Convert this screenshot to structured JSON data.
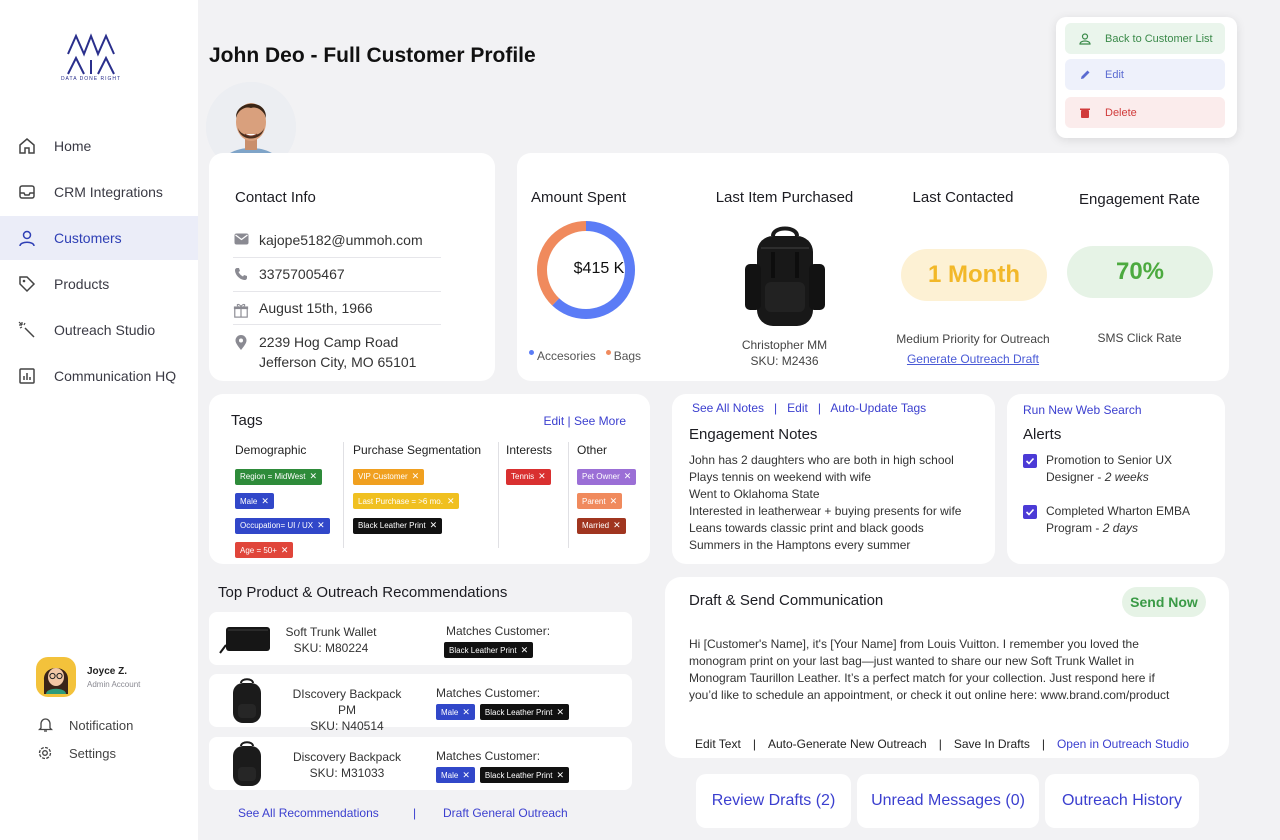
{
  "brand": {
    "name": "MINEME",
    "tagline": "DATA DONE RIGHT"
  },
  "sidebar": {
    "items": [
      {
        "label": "Home",
        "icon": "home-icon"
      },
      {
        "label": "CRM Integrations",
        "icon": "inbox-icon"
      },
      {
        "label": "Customers",
        "icon": "person-icon",
        "active": true
      },
      {
        "label": "Products",
        "icon": "tag-icon"
      },
      {
        "label": "Outreach Studio",
        "icon": "magic-wand-icon"
      },
      {
        "label": "Communication HQ",
        "icon": "bar-chart-icon"
      }
    ],
    "user": {
      "name": "Joyce Z.",
      "role": "Admin Account"
    },
    "notification_label": "Notification",
    "settings_label": "Settings"
  },
  "page": {
    "title": "John Deo - Full Customer Profile"
  },
  "actions": {
    "back_label": "Back to Customer List",
    "edit_label": "Edit",
    "delete_label": "Delete"
  },
  "contact": {
    "title": "Contact Info",
    "email": "kajope5182@ummoh.com",
    "phone": "33757005467",
    "birthday": "August 15th, 1966",
    "address_line1": "2239  Hog Camp Road",
    "address_line2": "Jefferson City, MO 65101"
  },
  "stats": {
    "amount_title": "Amount Spent",
    "amount_value": "$415 K",
    "legend": [
      "Accesories",
      "Bags"
    ],
    "donut": {
      "accessories_fraction": 0.62,
      "bags_fraction": 0.38,
      "colors": [
        "#5b7cf6",
        "#f08a5d"
      ]
    },
    "last_item_title": "Last Item Purchased",
    "last_item_name": "Christopher MM",
    "last_item_sku": "SKU: M2436",
    "last_contacted_title": "Last Contacted",
    "last_contacted_value": "1 Month",
    "priority_text": "Medium Priority for Outreach",
    "generate_link": "Generate Outreach Draft",
    "engagement_title": "Engagement Rate",
    "engagement_value": "70%",
    "engagement_sub": "SMS Click Rate"
  },
  "tags": {
    "title": "Tags",
    "edit_link": "Edit | See More",
    "columns": [
      {
        "title": "Demographic",
        "tags": [
          {
            "label": "Region = MidWest",
            "color": "#2e8b3a"
          },
          {
            "label": "Male",
            "color": "#3147c9"
          },
          {
            "label": "Occupation= UI / UX",
            "color": "#3147c9"
          },
          {
            "label": "Age = 50+",
            "color": "#e0453a"
          }
        ]
      },
      {
        "title": "Purchase Segmentation",
        "tags": [
          {
            "label": "VIP Customer",
            "color": "#f0a020"
          },
          {
            "label": "Last Purchase = >6 mo.",
            "color": "#f0c020"
          },
          {
            "label": "Black Leather Print",
            "color": "#111111"
          }
        ]
      },
      {
        "title": "Interests",
        "tags": [
          {
            "label": "Tennis",
            "color": "#d93030"
          }
        ]
      },
      {
        "title": "Other",
        "tags": [
          {
            "label": "Pet Owner",
            "color": "#9b6fd6"
          },
          {
            "label": "Parent",
            "color": "#f08a5d"
          },
          {
            "label": "Married",
            "color": "#a0351f"
          }
        ]
      }
    ]
  },
  "notes": {
    "links": [
      "See All Notes",
      "Edit",
      "Auto-Update Tags"
    ],
    "title": "Engagement Notes",
    "lines": [
      "John has 2 daughters who are both in high school",
      "Plays tennis on weekend with wife",
      "Went to Oklahoma State",
      "Interested in leatherwear + buying presents for wife",
      "Leans towards classic print and black goods",
      "Summers in the Hamptons every summer"
    ]
  },
  "alerts": {
    "link": "Run New Web Search",
    "title": "Alerts",
    "items": [
      {
        "line1": "Promotion to Senior UX",
        "line2a": "Designer - ",
        "line2b": "2 weeks"
      },
      {
        "line1": "Completed Wharton EMBA",
        "line2a": "Program - ",
        "line2b": "2 days"
      }
    ]
  },
  "recommendations": {
    "title": "Top Product & Outreach Recommendations",
    "match_label": "Matches Customer:",
    "items": [
      {
        "name": "Soft Trunk Wallet",
        "sku": "SKU: M80224",
        "tags": [
          {
            "label": "Black Leather Print",
            "color": "#111111"
          }
        ]
      },
      {
        "name": "DIscovery Backpack PM",
        "sku": "SKU: N40514",
        "tags": [
          {
            "label": "Male",
            "color": "#3147c9"
          },
          {
            "label": "Black Leather Print",
            "color": "#111111"
          }
        ]
      },
      {
        "name": "Discovery Backpack",
        "sku": "SKU: M31033",
        "tags": [
          {
            "label": "Male",
            "color": "#3147c9"
          },
          {
            "label": "Black Leather Print",
            "color": "#111111"
          }
        ]
      }
    ],
    "see_all": "See All Recommendations",
    "separator": "|",
    "draft_general": "Draft General Outreach"
  },
  "draft": {
    "title": "Draft & Send Communication",
    "send_now": "Send Now",
    "lines": [
      "Hi [Customer's Name], it's [Your Name] from Louis Vuitton. I remember you loved the",
      "monogram print on your last bag—just wanted to share our new Soft Trunk Wallet in",
      "Monogram Taurillon Leather. It’s a perfect match for your collection. Just respond here if",
      "you’d like to schedule an appointment, or check it out online here:  www.brand.com/product"
    ],
    "actions": [
      "Edit Text",
      "Auto-Generate New Outreach",
      "Save In Drafts",
      "Open in Outreach Studio"
    ],
    "separator": "|"
  },
  "bottom_buttons": [
    "Review Drafts (2)",
    "Unread Messages (0)",
    "Outreach History"
  ]
}
